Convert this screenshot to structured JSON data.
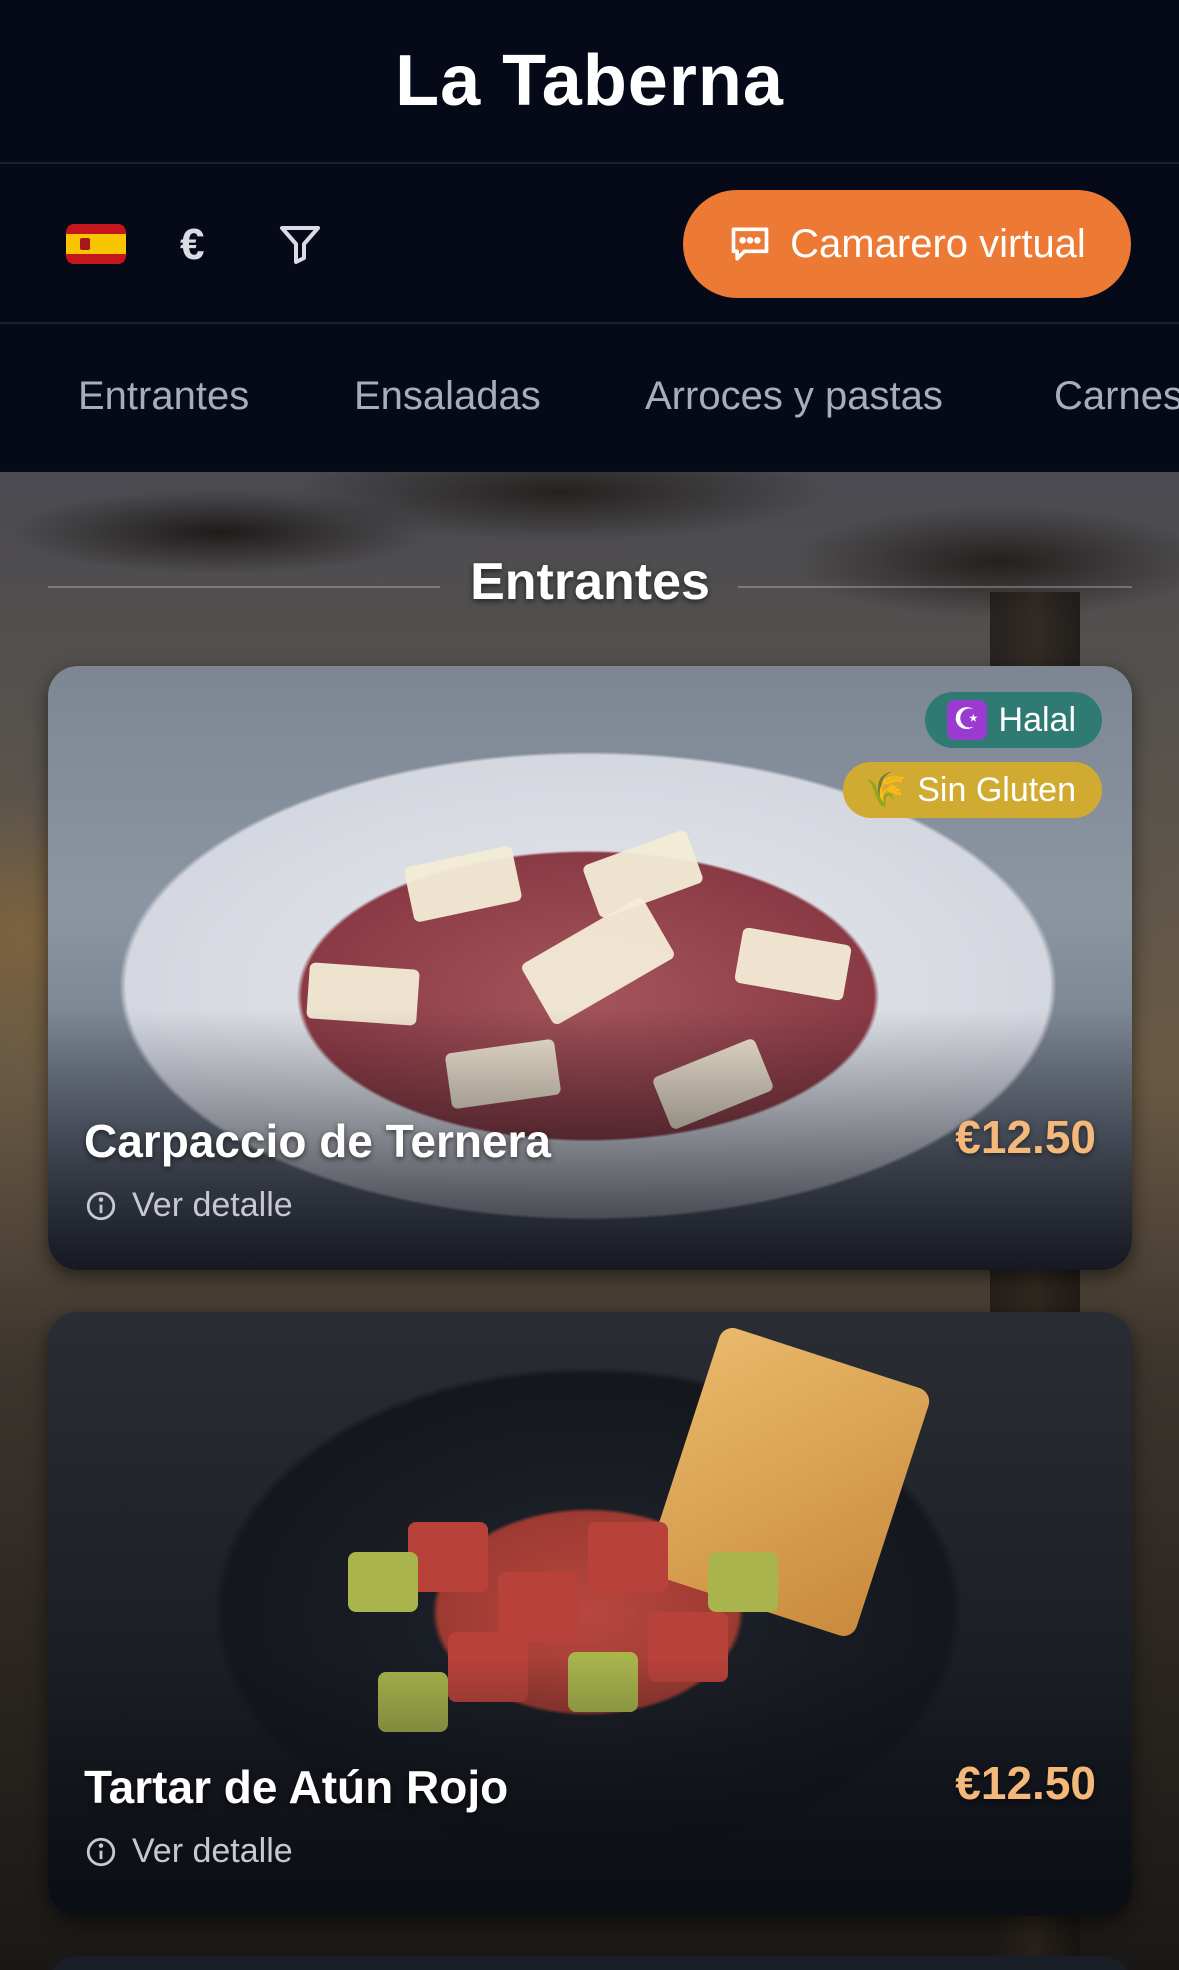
{
  "app": {
    "title": "La Taberna"
  },
  "toolbar": {
    "language_icon": "spain-flag-icon",
    "currency": "€",
    "filter_icon": "filter-icon",
    "virtual_waiter_label": "Camarero virtual",
    "virtual_waiter_icon": "chat-bubble-icon",
    "accent_color": "#ec7a35"
  },
  "tabs": [
    "Entrantes",
    "Ensaladas",
    "Arroces y pastas",
    "Carnes"
  ],
  "section": {
    "title": "Entrantes"
  },
  "dishes": [
    {
      "name": "Carpaccio de Ternera",
      "price": "€12.50",
      "detail_label": "Ver detalle",
      "badges": [
        {
          "label": "Halal",
          "icon": "crescent-star-icon",
          "color": "#2f7a73"
        },
        {
          "label": "Sin Gluten",
          "icon": "wheat-icon",
          "color": "#d1aa32"
        }
      ]
    },
    {
      "name": "Tartar de Atún Rojo",
      "price": "€12.50",
      "detail_label": "Ver detalle",
      "badges": []
    }
  ],
  "colors": {
    "background": "#060a18",
    "price": "#f4b87a"
  }
}
